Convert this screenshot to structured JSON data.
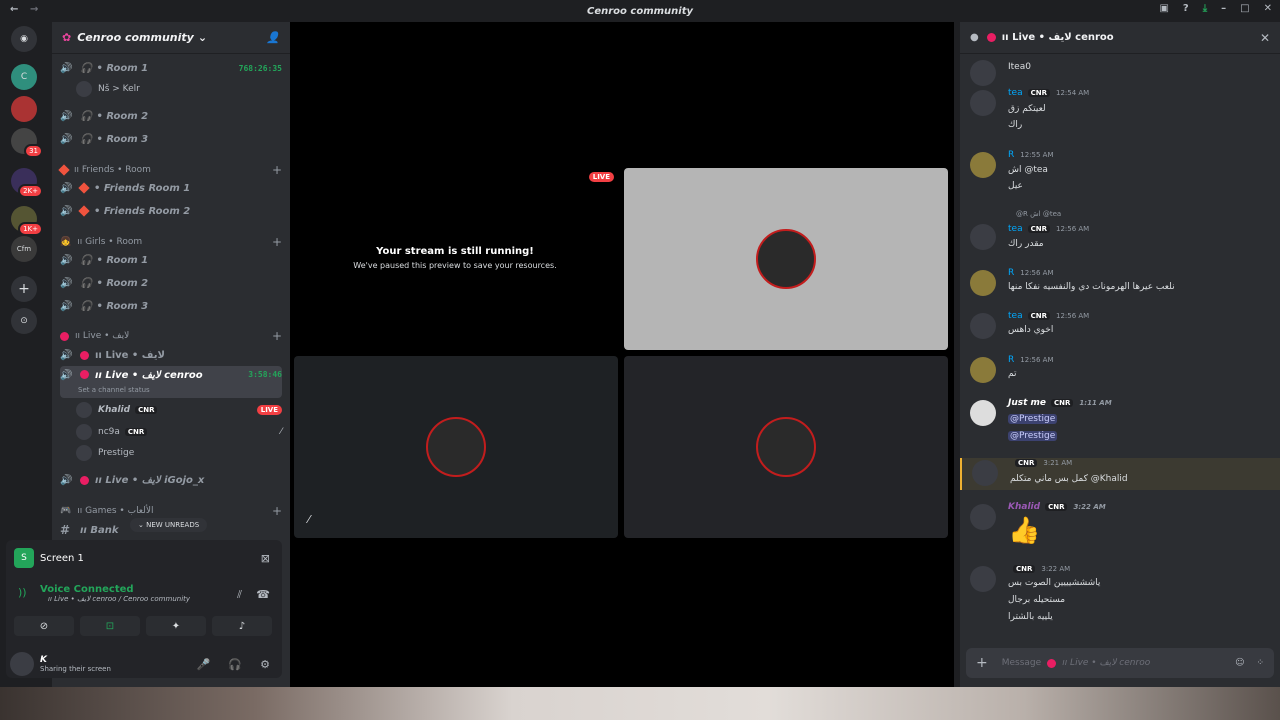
{
  "window": {
    "title": "Cenroo community",
    "back": "←",
    "forward": "→"
  },
  "servers": {
    "badges": [
      "31",
      "2K+",
      "1K+"
    ],
    "labels": [
      "C",
      "Cfm"
    ]
  },
  "guild": {
    "name": "Cenroo community"
  },
  "channels": [
    {
      "name": "• Room 1",
      "time": "768:26:35"
    },
    {
      "name": "• Room 2"
    },
    {
      "name": "• Room 3"
    },
    {
      "name": "• Friends Room 1"
    },
    {
      "name": "• Friends Room 2"
    },
    {
      "name": "• Room 1"
    },
    {
      "name": "• Room 2"
    },
    {
      "name": "• Room 3"
    },
    {
      "name": "ıı Live • لايف"
    },
    {
      "name": "ıı Live • لايف cenroo",
      "time": "3:58:46",
      "status": "Set a channel status"
    },
    {
      "name": "ıı Live • لايف iGojo_x"
    },
    {
      "name": "ıı Bank"
    }
  ],
  "room1_user": "Nš > Kelr",
  "categories": [
    "ıı Friends • Room",
    "ıı Girls • Room",
    "ıı Live • لايف",
    "ıı Games • الألعاب"
  ],
  "live_users": [
    {
      "name": "Khalid",
      "tag": "CNR",
      "live": "LIVE"
    },
    {
      "name": "nc9a",
      "tag": "CNR"
    },
    {
      "name": "Prestige"
    }
  ],
  "new_unreads": "NEW UNREADS",
  "screen_panel": {
    "title": "Screen 1",
    "voice_status": "Voice Connected",
    "voice_channel": "ıı Live • لايف cenroo / Cenroo community"
  },
  "user_bar": {
    "name": "K",
    "status": "Sharing their screen"
  },
  "stream": {
    "live_badge": "LIVE",
    "title": "Your stream is still running!",
    "subtitle": "We've paused this preview to save your resources."
  },
  "chat": {
    "title": "ıı Live • لايف cenroo",
    "composer_placeholder": "Message",
    "composer_channel": "ıı Live • لايف cenroo",
    "messages": [
      {
        "name": "",
        "tag": "",
        "time": "",
        "lines": [
          "Itea0"
        ]
      },
      {
        "name": "tea",
        "tag": "CNR",
        "time": "12:54 AM",
        "lines": [
          "لعيتكم زق",
          "راك"
        ]
      },
      {
        "name": "R",
        "tag": "",
        "time": "12:55 AM",
        "lines": [
          "اش @tea",
          "عيل"
        ]
      },
      {
        "name": "tea",
        "tag": "CNR",
        "time": "12:56 AM",
        "reply": "@R اش @tea",
        "lines": [
          "مقدر راك"
        ]
      },
      {
        "name": "R",
        "tag": "",
        "time": "12:56 AM",
        "lines": [
          "نلعب عيرها الهرمونات دي والنفسيه نفكا منها"
        ]
      },
      {
        "name": "tea",
        "tag": "CNR",
        "time": "12:56 AM",
        "lines": [
          "اخوي داهس"
        ]
      },
      {
        "name": "R",
        "tag": "",
        "time": "12:56 AM",
        "lines": [
          "تم"
        ]
      },
      {
        "name": "Just me",
        "tag": "CNR",
        "time": "1:11 AM",
        "lines": [
          "@Prestige",
          "@Prestige"
        ]
      },
      {
        "name": "",
        "tag": "CNR",
        "time": "3:21 AM",
        "lines": [
          "كمل بس ماني متكلم @Khalid"
        ]
      },
      {
        "name": "Khalid",
        "tag": "CNR",
        "time": "3:22 AM",
        "lines": [
          "👍"
        ]
      },
      {
        "name": "",
        "tag": "CNR",
        "time": "3:22 AM",
        "lines": [
          "ياشششيييين الصوت بس",
          "مستحيله برجال",
          "يلييه بالشترا"
        ]
      }
    ]
  }
}
